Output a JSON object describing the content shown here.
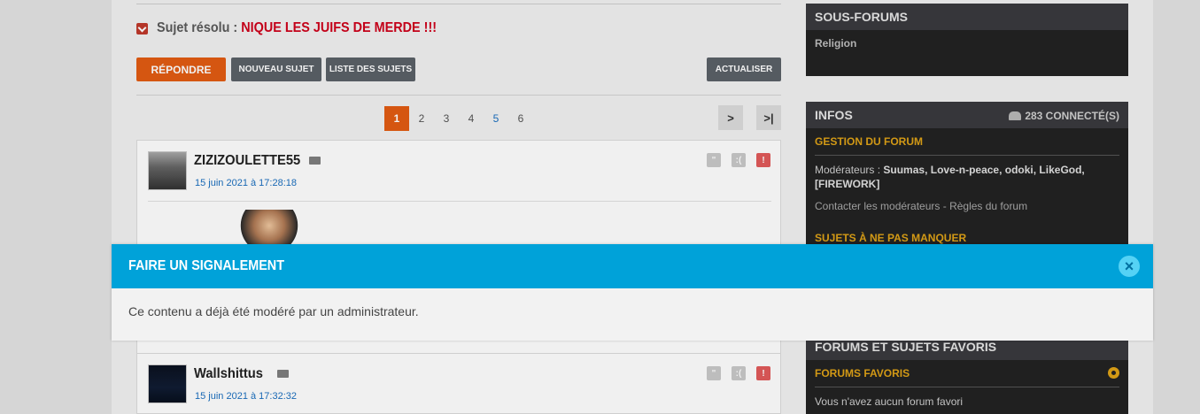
{
  "topic": {
    "prefix": "Sujet résolu :",
    "title": "NIQUE LES JUIFS DE MERDE !!!"
  },
  "toolbar": {
    "reply_label": "RÉPONDRE",
    "new_topic_label": "NOUVEAU SUJET",
    "list_label": "LISTE DES SUJETS",
    "refresh_label": "ACTUALISER"
  },
  "pagination": {
    "pages": [
      "1",
      "2",
      "3",
      "4",
      "5",
      "6"
    ],
    "current": "1",
    "next_label": ">",
    "last_label": ">|"
  },
  "posts": [
    {
      "author": "ZIZIZOULETTE55",
      "date": "15 juin 2021 à 17:28:18"
    },
    {
      "author": "Wallshittus",
      "date": "15 juin 2021 à 17:32:32"
    }
  ],
  "sidebar": {
    "subforums": {
      "title": "SOUS-FORUMS",
      "items": [
        "Religion"
      ]
    },
    "infos": {
      "title": "INFOS",
      "connected": "283 connecté(s)",
      "management_title": "GESTION DU FORUM",
      "moderators_label": "Modérateurs :",
      "moderators_list": "Suumas, Love-n-peace, odoki, LikeGod, [FIREWORK]",
      "contact_links": "Contacter les modérateurs - Règles du forum",
      "must_see_title": "SUJETS À NE PAS MANQUER"
    },
    "favorites": {
      "title": "FORUMS ET SUJETS FAVORIS",
      "forums_title": "FORUMS FAVORIS",
      "empty_text": "Vous n'avez aucun forum favori"
    }
  },
  "modal": {
    "title": "FAIRE UN SIGNALEMENT",
    "message": "Ce contenu a déjà été modéré par un administrateur.",
    "close_symbol": "×"
  },
  "icons": {
    "collapse": "chevron-down-icon",
    "mail": "mail-icon",
    "quote": "quote-icon",
    "sad": "sad-face-icon",
    "alert": "alert-icon",
    "users": "users-icon",
    "settings": "gear-icon",
    "close": "close-icon"
  },
  "colors": {
    "accent_orange": "#e35c13",
    "modal_blue": "#00a2d9",
    "title_red": "#d0021b",
    "sidebar_gold": "#e0a317",
    "date_blue": "#1a6fc0"
  }
}
